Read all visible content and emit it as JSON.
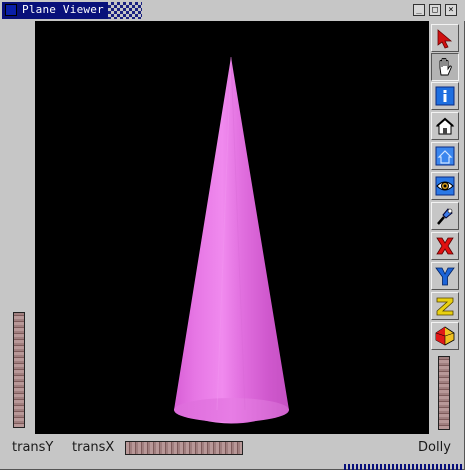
{
  "window": {
    "title": "Plane Viewer",
    "controls": [
      "minimize",
      "maximize",
      "close"
    ]
  },
  "viewport": {
    "background": "#000000",
    "object": "cone",
    "object_color": "#e27ae0"
  },
  "bottom_bar": {
    "transY_label": "transY",
    "transX_label": "transX",
    "dolly_label": "Dolly"
  },
  "toolbar": {
    "items": [
      {
        "name": "select-arrow",
        "state": "normal"
      },
      {
        "name": "view-hand",
        "state": "pressed"
      },
      {
        "name": "help-info",
        "state": "normal"
      },
      {
        "name": "home",
        "state": "normal"
      },
      {
        "name": "set-home",
        "state": "normal"
      },
      {
        "name": "view-all-eye",
        "state": "normal"
      },
      {
        "name": "seek",
        "state": "normal"
      },
      {
        "name": "x-plane",
        "state": "normal"
      },
      {
        "name": "y-plane",
        "state": "normal"
      },
      {
        "name": "z-plane",
        "state": "normal"
      },
      {
        "name": "camera-toggle",
        "state": "normal"
      }
    ]
  }
}
